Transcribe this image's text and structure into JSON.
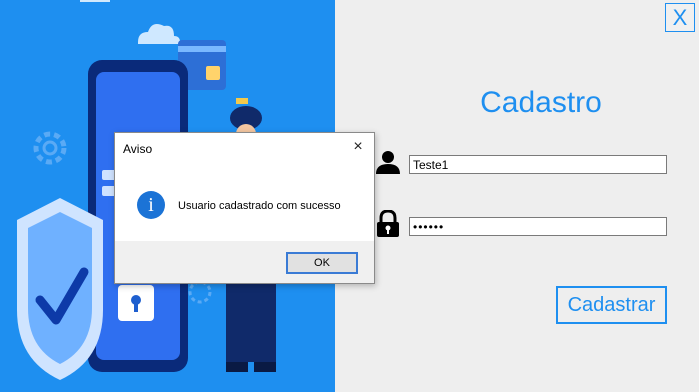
{
  "app": {
    "close_label": "X",
    "title": "Cadastro"
  },
  "form": {
    "username_value": "Teste1",
    "password_value": "••••••",
    "submit_label": "Cadastrar"
  },
  "dialog": {
    "title": "Aviso",
    "close_label": "×",
    "icon_glyph": "i",
    "message": "Usuario cadastrado com sucesso",
    "ok_label": "OK"
  },
  "colors": {
    "accent": "#1e8ff0",
    "panel_bg": "#eeeeee"
  },
  "icons": [
    "user-icon",
    "lock-icon",
    "info-icon",
    "close-icon"
  ]
}
